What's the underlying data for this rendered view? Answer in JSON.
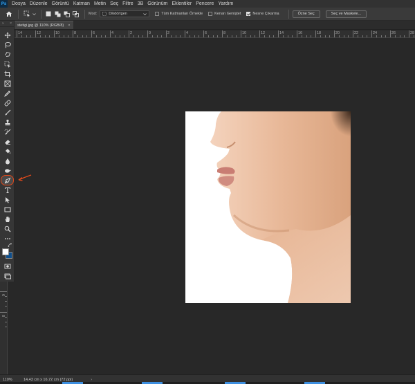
{
  "menubar": {
    "items": [
      "Dosya",
      "Düzenle",
      "Görüntü",
      "Katman",
      "Metin",
      "Seç",
      "Filtre",
      "3B",
      "Görünüm",
      "Eklentiler",
      "Pencere",
      "Yardım"
    ]
  },
  "options": {
    "mode_label": "Mod:",
    "mode_value": "Dikdörtgen",
    "check_sample_all": "Tüm Katmanları Örnekle",
    "check_hard_edge": "Kenarı Geniştet",
    "check_object_subtract": "Nesne Çıkarma",
    "check_object_subtract_on": true,
    "btn_select_subject": "Özne Seç",
    "btn_select_mask": "Seç ve Maskele..."
  },
  "document": {
    "tab_title": "stetigi.jpg @ 110% (RGB/8)",
    "close_symbol": "×"
  },
  "toolbar": {
    "head_symbol": "»",
    "head_close": "×",
    "active_tool": "pen-tool"
  },
  "ruler": {
    "h_labels": [
      "14",
      "12",
      "10",
      "8",
      "6",
      "4",
      "2",
      "0",
      "2",
      "4",
      "6",
      "8",
      "10",
      "12",
      "14",
      "16",
      "18",
      "20",
      "22",
      "24",
      "26",
      "28"
    ],
    "v_labels": [
      "6",
      "8"
    ]
  },
  "status": {
    "zoom": "110%",
    "doc_info": "14,43 cm x 16,72 cm (72 ppi)",
    "arrow": "›"
  },
  "colors": {
    "accent": "#e24a1b",
    "foreground_swatch": "#ffffff",
    "background_swatch": "#0f4f8c"
  }
}
